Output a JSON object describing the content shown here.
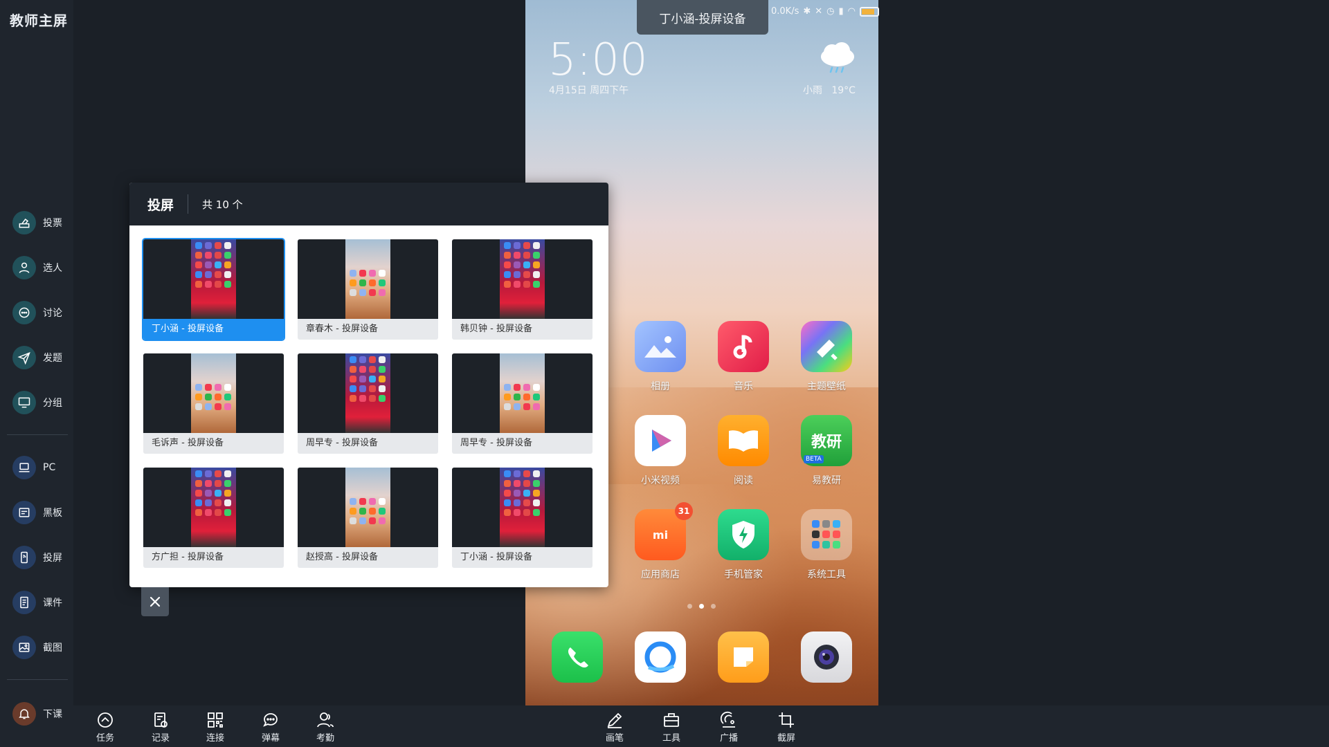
{
  "app": {
    "title": "教师主屏"
  },
  "sidebar": {
    "items": [
      {
        "label": "投票",
        "icon": "vote-icon"
      },
      {
        "label": "选人",
        "icon": "person-icon"
      },
      {
        "label": "讨论",
        "icon": "chat-icon"
      },
      {
        "label": "发题",
        "icon": "send-icon"
      },
      {
        "label": "分组",
        "icon": "monitor-icon"
      },
      {
        "label": "PC",
        "icon": "laptop-icon"
      },
      {
        "label": "黑板",
        "icon": "board-icon"
      },
      {
        "label": "投屏",
        "icon": "cast-phone-icon"
      },
      {
        "label": "课件",
        "icon": "document-icon"
      },
      {
        "label": "截图",
        "icon": "image-icon"
      }
    ],
    "end_class": {
      "label": "下课",
      "icon": "bell-icon"
    }
  },
  "toolbar": {
    "left": [
      {
        "label": "任务",
        "icon": "task-icon"
      },
      {
        "label": "记录",
        "icon": "record-icon"
      },
      {
        "label": "连接",
        "icon": "qrcode-icon"
      },
      {
        "label": "弹幕",
        "icon": "barrage-icon"
      },
      {
        "label": "考勤",
        "icon": "attendance-icon"
      }
    ],
    "right": [
      {
        "label": "画笔",
        "icon": "pen-icon"
      },
      {
        "label": "工具",
        "icon": "toolbox-icon"
      },
      {
        "label": "广播",
        "icon": "broadcast-icon"
      },
      {
        "label": "截屏",
        "icon": "crop-icon"
      }
    ]
  },
  "phone": {
    "cast_banner": "丁小涵-投屏设备",
    "status_speed": "0.0K/s",
    "clock": "5:00",
    "date": "4月15日 周四下午",
    "weather": "小雨",
    "temperature": "19°C",
    "apps": [
      {
        "name": "相册",
        "color": "#7fa8f2"
      },
      {
        "name": "音乐",
        "color": "#f2394f"
      },
      {
        "name": "主题壁纸",
        "color": "#f06bb0"
      },
      {
        "name": "小米视频",
        "color": "#ffffff"
      },
      {
        "name": "阅读",
        "color": "#ff9b1e"
      },
      {
        "name": "易教研",
        "color": "#2fb54a",
        "text": "教研",
        "tag": "BETA"
      },
      {
        "name": "应用商店",
        "color": "#ff6a2c",
        "badge": "31",
        "text": "mi"
      },
      {
        "name": "手机管家",
        "color": "#1fc87a"
      },
      {
        "name": "系统工具",
        "color": "rgba(255,255,255,0.35)"
      }
    ],
    "dock_apps": [
      "phone-app",
      "browser-app",
      "notes-app",
      "camera-app"
    ]
  },
  "cast_dialog": {
    "title": "投屏",
    "count": "共 10 个",
    "devices": [
      {
        "label": "丁小涵 - 投屏设备",
        "style": "ios",
        "selected": true
      },
      {
        "label": "章春木 - 投屏设备",
        "style": "miui"
      },
      {
        "label": "韩贝钟 - 投屏设备",
        "style": "ios"
      },
      {
        "label": "毛诉声 - 投屏设备",
        "style": "miui"
      },
      {
        "label": "周早专 - 投屏设备",
        "style": "ios"
      },
      {
        "label": "周早专 - 投屏设备",
        "style": "miui"
      },
      {
        "label": "方广担 - 投屏设备",
        "style": "ios"
      },
      {
        "label": "赵授高 - 投屏设备",
        "style": "miui"
      },
      {
        "label": "丁小涵 - 投屏设备",
        "style": "ios"
      }
    ]
  }
}
